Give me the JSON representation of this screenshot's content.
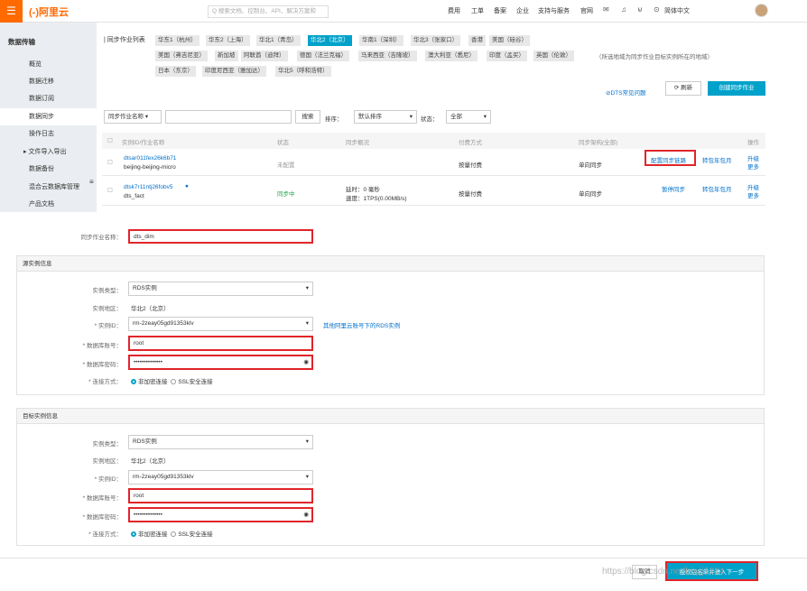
{
  "topbar": {
    "menu": "☰",
    "logo": "(-)阿里云",
    "search_placeholder": "Q 搜索文档、控制台、API、解决方案和",
    "nav": [
      "费用",
      "工单",
      "备案",
      "企业",
      "支持与服务",
      "官网"
    ],
    "lang": "简体中文"
  },
  "sidebar": {
    "title": "数据传输",
    "items": [
      "概览",
      "数据迁移",
      "数据订阅",
      "数据同步",
      "操作日志",
      "文件导入导出",
      "数据备份",
      "混合云数据库管理",
      "产品文档"
    ],
    "active": "数据同步"
  },
  "regions": {
    "label": "| 同步作业列表",
    "row1": [
      "华东1（杭州）",
      "华东2（上海）",
      "华北1（青岛）",
      "华北2（北京）",
      "华南1（深圳）",
      "华北3（张家口）",
      "香港",
      "美国（硅谷）"
    ],
    "row2": [
      "美国（弗吉尼亚）",
      "新加坡",
      "阿联酋（迪拜）",
      "德国（法兰克福）",
      "马来西亚（吉隆坡）",
      "澳大利亚（悉尼）",
      "印度（孟买）",
      "英国（伦敦）"
    ],
    "row3": [
      "日本（东京）",
      "印度尼西亚（雅加达）",
      "华北5（呼和浩特）"
    ],
    "selected": "华北2（北京）",
    "note": "（所选地域为同步作业目标实例所在的地域）"
  },
  "actions": {
    "faq": "DTS常见问题",
    "refresh": "刷新",
    "create": "创建同步作业"
  },
  "filter": {
    "field": "同步作业名称",
    "search": "搜索",
    "sort_label": "排序：",
    "sort_value": "默认排序",
    "status_label": "状态：",
    "status_value": "全部"
  },
  "table": {
    "headers": [
      "实例ID/作业名称",
      "状态",
      "同步概况",
      "付费方式",
      "同步架构(全部)",
      "操作"
    ],
    "rows": [
      {
        "id": "dtsar011fex26k6b71",
        "name": "beijing-beijing-micro",
        "status": "未配置",
        "overview1": "",
        "overview2": "",
        "pay": "按量付费",
        "arch": "单向同步",
        "op1": "配置同步链路",
        "op2": "转包年包月",
        "op3": "升级",
        "op4": "更多"
      },
      {
        "id": "dtsk7r11ntj26fobv5",
        "name": "dts_fact",
        "status": "同步中",
        "overview1": "延时：0 毫秒",
        "overview2": "速度：1TPS(0.00MB/s)",
        "pay": "按量付费",
        "arch": "单向同步",
        "op1": "暂停同步",
        "op2": "转包年包月",
        "op3": "升级",
        "op4": "更多"
      }
    ]
  },
  "form": {
    "job_name_label": "同步作业名称：",
    "job_name": "dts_dim",
    "source": {
      "title": "源实例信息",
      "type_label": "实例类型：",
      "type": "RDS实例",
      "region_label": "实例地区：",
      "region": "华北2（北京）",
      "id_label": "* 实例ID：",
      "id": "rm-2zeay05gd91353klv",
      "other_link": "其他阿里云账号下的RDS实例",
      "user_label": "* 数据库账号：",
      "user": "root",
      "pwd_label": "* 数据库密码：",
      "pwd": "••••••••••••••",
      "conn_label": "* 连接方式：",
      "conn1": "非加密连接",
      "conn2": "SSL安全连接"
    },
    "target": {
      "title": "目标实例信息",
      "type_label": "实例类型：",
      "type": "RDS实例",
      "region_label": "实例地区：",
      "region": "华北2（北京）",
      "id_label": "* 实例ID：",
      "id": "rm-2zeay05gd91353klv",
      "user_label": "* 数据库账号：",
      "user": "root",
      "pwd_label": "* 数据库密码：",
      "pwd": "••••••••••••••",
      "conn_label": "* 连接方式：",
      "conn1": "非加密连接",
      "conn2": "SSL安全连接"
    }
  },
  "footer": {
    "cancel": "取消",
    "next": "授权白名单并进入下一步",
    "watermark": "https://blog.csdn.net/bbyjj1314"
  }
}
